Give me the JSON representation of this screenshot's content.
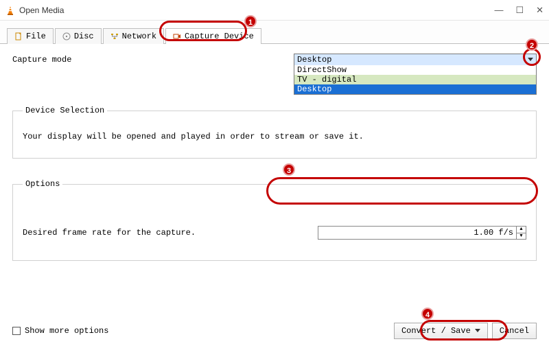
{
  "window": {
    "title": "Open Media"
  },
  "tabs": {
    "file": "File",
    "disc": "Disc",
    "network": "Network",
    "capture": "Capture Device"
  },
  "capture": {
    "mode_label": "Capture mode",
    "selected": "Desktop",
    "options": [
      "DirectShow",
      "TV - digital",
      "Desktop"
    ]
  },
  "device_selection": {
    "legend": "Device Selection",
    "desc": "Your display will be opened and played in order to stream or save it."
  },
  "options": {
    "legend": "Options",
    "fps_label": "Desired frame rate for the capture.",
    "fps_value": "1.00 f/s"
  },
  "footer": {
    "show_more": "Show more options",
    "convert": "Convert / Save",
    "cancel": "Cancel"
  },
  "annotations": {
    "b1": "1",
    "b2": "2",
    "b3": "3",
    "b4": "4"
  }
}
